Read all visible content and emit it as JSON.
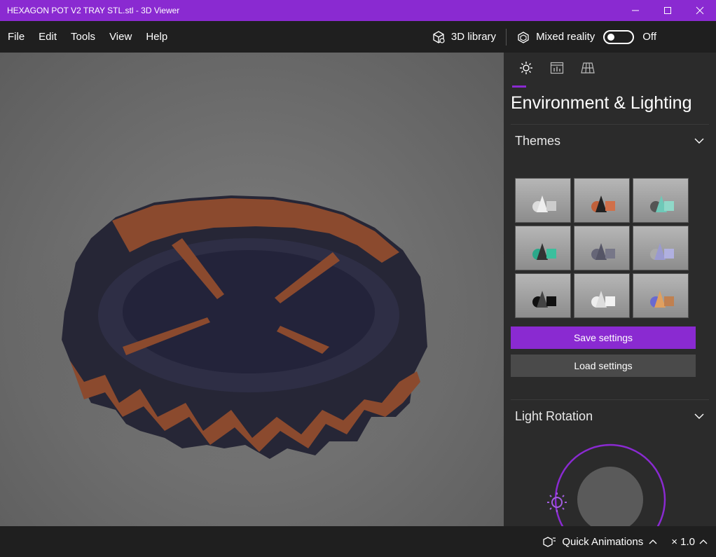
{
  "window": {
    "title": "HEXAGON POT V2 TRAY STL.stl - 3D Viewer"
  },
  "menu": {
    "items": [
      "File",
      "Edit",
      "Tools",
      "View",
      "Help"
    ]
  },
  "toolbar": {
    "library_label": "3D library",
    "mixed_reality_label": "Mixed reality",
    "mixed_reality_state": "Off"
  },
  "panel": {
    "title": "Environment & Lighting",
    "tabs": [
      "lighting-icon",
      "stats-icon",
      "grid-icon"
    ],
    "themes": {
      "label": "Themes",
      "count": 9
    },
    "save_label": "Save settings",
    "load_label": "Load settings",
    "rotation": {
      "label": "Light Rotation"
    }
  },
  "status": {
    "animations_label": "Quick Animations",
    "speed": "× 1.0"
  },
  "colors": {
    "accent": "#8a2ad1",
    "model_outer": "#262636",
    "model_inner": "#8b4a2e"
  }
}
